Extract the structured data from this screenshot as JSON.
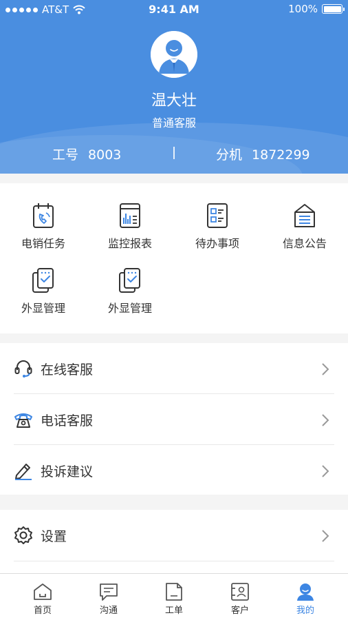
{
  "status_bar": {
    "carrier": "AT&T",
    "time": "9:41 AM",
    "battery": "100%"
  },
  "profile": {
    "name": "温大壮",
    "role": "普通客服",
    "employee_id_label": "工号",
    "employee_id": "8003",
    "extension_label": "分机",
    "extension": "1872299"
  },
  "grid": [
    {
      "label": "电销任务",
      "icon": "calendar-phone-icon"
    },
    {
      "label": "监控报表",
      "icon": "report-chart-icon"
    },
    {
      "label": "待办事项",
      "icon": "todo-list-icon"
    },
    {
      "label": "信息公告",
      "icon": "notice-icon"
    },
    {
      "label": "外显管理",
      "icon": "display-manage-icon"
    },
    {
      "label": "外显管理",
      "icon": "display-manage-icon"
    }
  ],
  "support": [
    {
      "label": "在线客服",
      "icon": "headset-icon"
    },
    {
      "label": "电话客服",
      "icon": "telephone-icon"
    },
    {
      "label": "投诉建议",
      "icon": "pen-icon"
    }
  ],
  "settings": {
    "label": "设置",
    "icon": "gear-icon"
  },
  "tabs": [
    {
      "label": "首页",
      "icon": "home-icon"
    },
    {
      "label": "沟通",
      "icon": "chat-icon"
    },
    {
      "label": "工单",
      "icon": "document-icon"
    },
    {
      "label": "客户",
      "icon": "contact-card-icon"
    },
    {
      "label": "我的",
      "icon": "profile-icon",
      "active": true
    }
  ],
  "colors": {
    "primary": "#4a8ee0",
    "active_tab": "#3d86e3"
  }
}
